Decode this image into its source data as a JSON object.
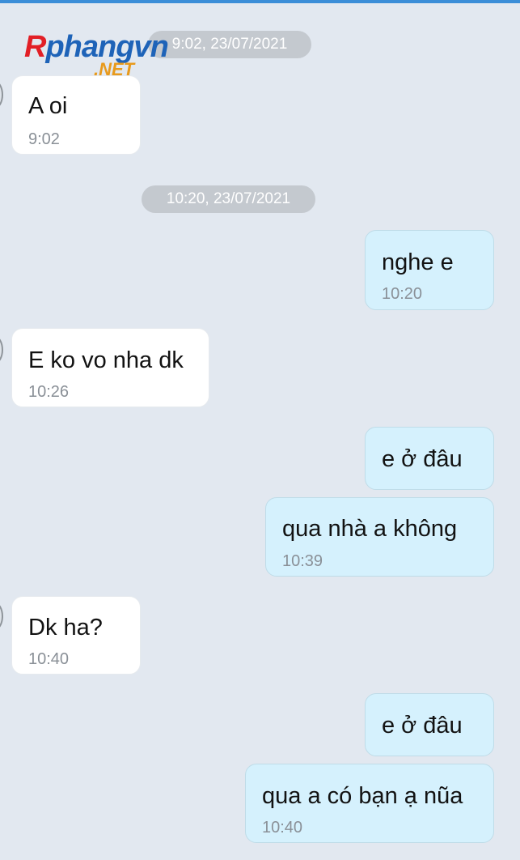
{
  "colors": {
    "background": "#e2e8f0",
    "incoming_bubble": "#ffffff",
    "outgoing_bubble": "#d5f1fd",
    "divider_pill": "#c4c9cf",
    "top_accent": "#3b8ed8"
  },
  "watermark": {
    "brand_r": "R",
    "brand_rest": "phangvn",
    "suffix": ".NET"
  },
  "dividers": [
    {
      "label": "9:02, 23/07/2021"
    },
    {
      "label": "10:20, 23/07/2021"
    }
  ],
  "messages": [
    {
      "direction": "incoming",
      "text": "A oi",
      "time": "9:02"
    },
    {
      "direction": "outgoing",
      "text": "nghe e",
      "time": "10:20"
    },
    {
      "direction": "incoming",
      "text": "E ko vo nha dk",
      "time": "10:26"
    },
    {
      "direction": "outgoing",
      "text": "e ở đâu",
      "time": ""
    },
    {
      "direction": "outgoing",
      "text": "qua nhà a không",
      "time": "10:39"
    },
    {
      "direction": "incoming",
      "text": "Dk ha?",
      "time": "10:40"
    },
    {
      "direction": "outgoing",
      "text": "e ở đâu",
      "time": ""
    },
    {
      "direction": "outgoing",
      "text": "qua a có bạn ạ nũa",
      "time": "10:40"
    }
  ]
}
